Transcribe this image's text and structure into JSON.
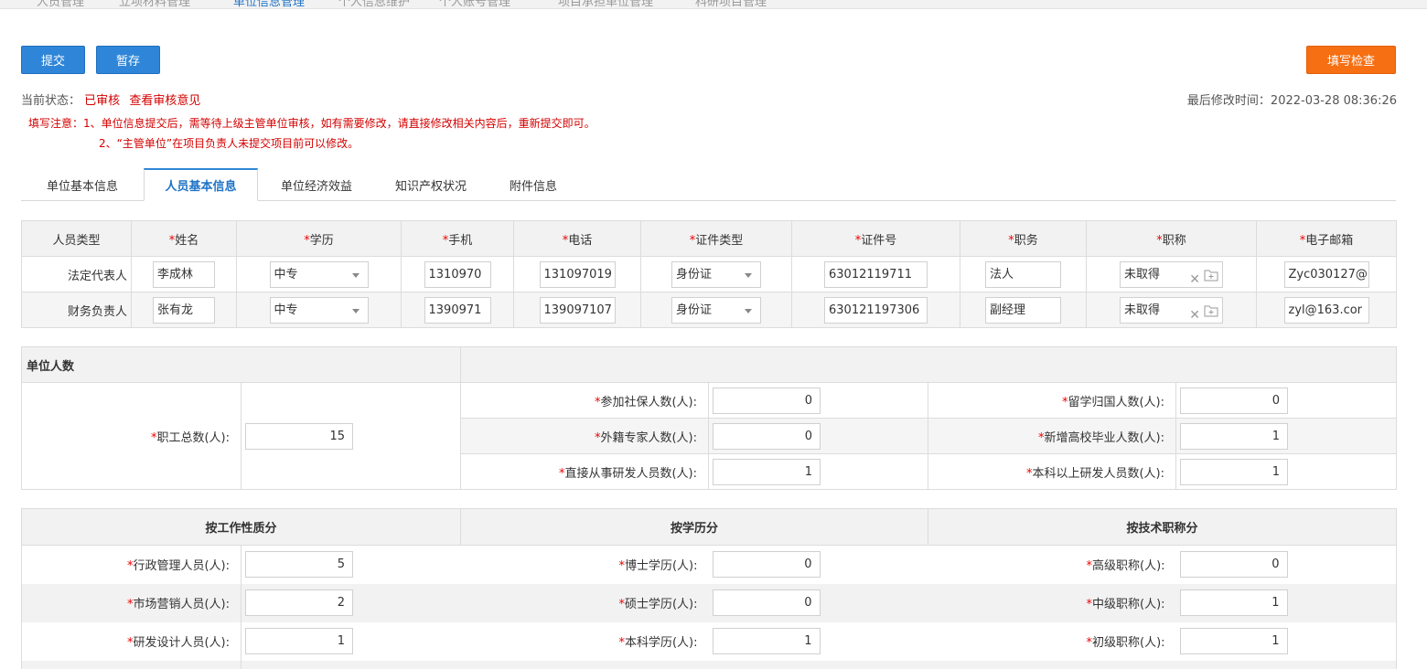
{
  "top_nav": [
    "人员管理",
    "立项材料管理",
    "单位信息管理",
    "个人信息维护",
    "个人账号管理",
    "项目承担单位管理",
    "科研项目管理"
  ],
  "toolbar": {
    "submit": "提交",
    "save_draft": "暂存",
    "check": "填写检查"
  },
  "status": {
    "label": "当前状态：",
    "value": "已审核",
    "link": "查看审核意见"
  },
  "modified": {
    "label": "最后修改时间：",
    "value": "2022-03-28 08:36:26"
  },
  "notice": {
    "line1": "填写注意：1、单位信息提交后，需等待上级主管单位审核，如有需要修改，请直接修改相关内容后，重新提交即可。",
    "line2": "2、“主管单位”在项目负责人未提交项目前可以修改。"
  },
  "tabs": [
    "单位基本信息",
    "人员基本信息",
    "单位经济效益",
    "知识产权状况",
    "附件信息"
  ],
  "colors": {
    "primary": "#2f86d8",
    "accent": "#f66f13",
    "required": "#e00000",
    "notice": "#d40000"
  },
  "staff_table": {
    "headers": [
      "人员类型",
      "姓名",
      "学历",
      "手机",
      "电话",
      "证件类型",
      "证件号",
      "职务",
      "职称",
      "电子邮箱"
    ],
    "rows": [
      {
        "type": "法定代表人",
        "name": "李成林",
        "edu": "中专",
        "mobile": "1310970",
        "phone": "131097019",
        "id_type": "身份证",
        "id_no": "63012119711",
        "position": "法人",
        "title": "未取得",
        "email": "Zyc030127@"
      },
      {
        "type": "财务负责人",
        "name": "张有龙",
        "edu": "中专",
        "mobile": "1390971",
        "phone": "139097107",
        "id_type": "身份证",
        "id_no": "630121197306",
        "position": "副经理",
        "title": "未取得",
        "email": "zyl@163.cor"
      }
    ]
  },
  "unit_count": {
    "header": "单位人数",
    "total_label": "职工总数(人):",
    "total": "15",
    "rows": [
      {
        "l1": "参加社保人数(人):",
        "v1": "0",
        "l2": "留学归国人数(人):",
        "v2": "0"
      },
      {
        "l1": "外籍专家人数(人):",
        "v1": "0",
        "l2": "新增高校毕业人数(人):",
        "v2": "1"
      },
      {
        "l1": "直接从事研发人员数(人):",
        "v1": "1",
        "l2": "本科以上研发人员数(人):",
        "v2": "1"
      }
    ]
  },
  "distribution": {
    "headers": [
      "按工作性质分",
      "按学历分",
      "按技术职称分"
    ],
    "rows": [
      {
        "a_label": "行政管理人员(人):",
        "a": "5",
        "b_label": "博士学历(人):",
        "b": "0",
        "c_label": "高级职称(人):",
        "c": "0"
      },
      {
        "a_label": "市场营销人员(人):",
        "a": "2",
        "b_label": "硕士学历(人):",
        "b": "0",
        "c_label": "中级职称(人):",
        "c": "1"
      },
      {
        "a_label": "研发设计人员(人):",
        "a": "1",
        "b_label": "本科学历(人):",
        "b": "1",
        "c_label": "初级职称(人):",
        "c": "1"
      }
    ]
  }
}
